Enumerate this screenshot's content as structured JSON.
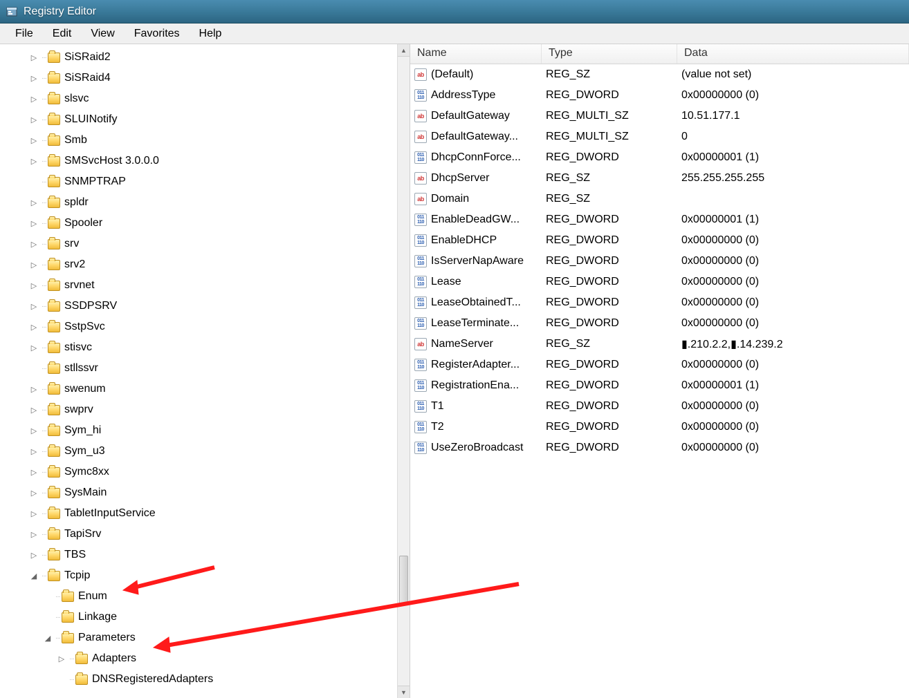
{
  "window": {
    "title": "Registry Editor"
  },
  "menu": {
    "items": [
      "File",
      "Edit",
      "View",
      "Favorites",
      "Help"
    ]
  },
  "list": {
    "columns": {
      "name": "Name",
      "type": "Type",
      "data": "Data"
    }
  },
  "tree": {
    "nodes": [
      {
        "label": "SiSRaid2",
        "depth": 1,
        "expander": "▷"
      },
      {
        "label": "SiSRaid4",
        "depth": 1,
        "expander": "▷"
      },
      {
        "label": "slsvc",
        "depth": 1,
        "expander": "▷"
      },
      {
        "label": "SLUINotify",
        "depth": 1,
        "expander": "▷"
      },
      {
        "label": "Smb",
        "depth": 1,
        "expander": "▷"
      },
      {
        "label": "SMSvcHost 3.0.0.0",
        "depth": 1,
        "expander": "▷"
      },
      {
        "label": "SNMPTRAP",
        "depth": 1,
        "expander": ""
      },
      {
        "label": "spldr",
        "depth": 1,
        "expander": "▷"
      },
      {
        "label": "Spooler",
        "depth": 1,
        "expander": "▷"
      },
      {
        "label": "srv",
        "depth": 1,
        "expander": "▷"
      },
      {
        "label": "srv2",
        "depth": 1,
        "expander": "▷"
      },
      {
        "label": "srvnet",
        "depth": 1,
        "expander": "▷"
      },
      {
        "label": "SSDPSRV",
        "depth": 1,
        "expander": "▷"
      },
      {
        "label": "SstpSvc",
        "depth": 1,
        "expander": "▷"
      },
      {
        "label": "stisvc",
        "depth": 1,
        "expander": "▷"
      },
      {
        "label": "stllssvr",
        "depth": 1,
        "expander": ""
      },
      {
        "label": "swenum",
        "depth": 1,
        "expander": "▷"
      },
      {
        "label": "swprv",
        "depth": 1,
        "expander": "▷"
      },
      {
        "label": "Sym_hi",
        "depth": 1,
        "expander": "▷"
      },
      {
        "label": "Sym_u3",
        "depth": 1,
        "expander": "▷"
      },
      {
        "label": "Symc8xx",
        "depth": 1,
        "expander": "▷"
      },
      {
        "label": "SysMain",
        "depth": 1,
        "expander": "▷"
      },
      {
        "label": "TabletInputService",
        "depth": 1,
        "expander": "▷"
      },
      {
        "label": "TapiSrv",
        "depth": 1,
        "expander": "▷"
      },
      {
        "label": "TBS",
        "depth": 1,
        "expander": "▷"
      },
      {
        "label": "Tcpip",
        "depth": 1,
        "expander": "◢"
      },
      {
        "label": "Enum",
        "depth": 2,
        "expander": ""
      },
      {
        "label": "Linkage",
        "depth": 2,
        "expander": ""
      },
      {
        "label": "Parameters",
        "depth": 2,
        "expander": "◢"
      },
      {
        "label": "Adapters",
        "depth": 3,
        "expander": "▷"
      },
      {
        "label": "DNSRegisteredAdapters",
        "depth": 3,
        "expander": ""
      }
    ]
  },
  "values": [
    {
      "name": "(Default)",
      "type": "REG_SZ",
      "data": "(value not set)",
      "icon": "sz"
    },
    {
      "name": "AddressType",
      "type": "REG_DWORD",
      "data": "0x00000000 (0)",
      "icon": "dw"
    },
    {
      "name": "DefaultGateway",
      "type": "REG_MULTI_SZ",
      "data": "10.51.177.1",
      "icon": "sz"
    },
    {
      "name": "DefaultGateway...",
      "type": "REG_MULTI_SZ",
      "data": "0",
      "icon": "sz"
    },
    {
      "name": "DhcpConnForce...",
      "type": "REG_DWORD",
      "data": "0x00000001 (1)",
      "icon": "dw"
    },
    {
      "name": "DhcpServer",
      "type": "REG_SZ",
      "data": "255.255.255.255",
      "icon": "sz"
    },
    {
      "name": "Domain",
      "type": "REG_SZ",
      "data": "",
      "icon": "sz"
    },
    {
      "name": "EnableDeadGW...",
      "type": "REG_DWORD",
      "data": "0x00000001 (1)",
      "icon": "dw"
    },
    {
      "name": "EnableDHCP",
      "type": "REG_DWORD",
      "data": "0x00000000 (0)",
      "icon": "dw"
    },
    {
      "name": "IsServerNapAware",
      "type": "REG_DWORD",
      "data": "0x00000000 (0)",
      "icon": "dw"
    },
    {
      "name": "Lease",
      "type": "REG_DWORD",
      "data": "0x00000000 (0)",
      "icon": "dw"
    },
    {
      "name": "LeaseObtainedT...",
      "type": "REG_DWORD",
      "data": "0x00000000 (0)",
      "icon": "dw"
    },
    {
      "name": "LeaseTerminate...",
      "type": "REG_DWORD",
      "data": "0x00000000 (0)",
      "icon": "dw"
    },
    {
      "name": "NameServer",
      "type": "REG_SZ",
      "data": "▮.210.2.2,▮.14.239.2",
      "icon": "sz"
    },
    {
      "name": "RegisterAdapter...",
      "type": "REG_DWORD",
      "data": "0x00000000 (0)",
      "icon": "dw"
    },
    {
      "name": "RegistrationEna...",
      "type": "REG_DWORD",
      "data": "0x00000001 (1)",
      "icon": "dw"
    },
    {
      "name": "T1",
      "type": "REG_DWORD",
      "data": "0x00000000 (0)",
      "icon": "dw"
    },
    {
      "name": "T2",
      "type": "REG_DWORD",
      "data": "0x00000000 (0)",
      "icon": "dw"
    },
    {
      "name": "UseZeroBroadcast",
      "type": "REG_DWORD",
      "data": "0x00000000 (0)",
      "icon": "dw"
    }
  ]
}
